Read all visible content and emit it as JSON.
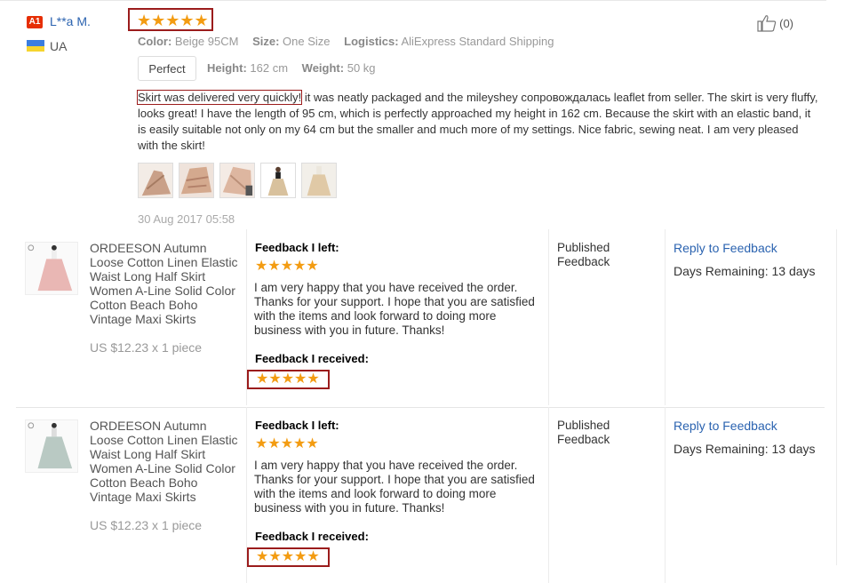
{
  "review": {
    "badge": "A1",
    "username": "L**a M.",
    "country": "UA",
    "stars": "★★★★★",
    "helpful_count": "(0)",
    "color_label": "Color:",
    "color_value": "Beige 95CM",
    "size_label": "Size:",
    "size_value": "One Size",
    "logistics_label": "Logistics:",
    "logistics_value": "AliExpress Standard Shipping",
    "fit": "Perfect",
    "height_label": "Height:",
    "height_value": "162 cm",
    "weight_label": "Weight:",
    "weight_value": "50 kg",
    "text_highlight": "Skirt was delivered very quickly!",
    "text_rest": " it was neatly packaged and the mileyshey сопровождалась leaflet from seller. The skirt is very fluffy, looks great! I have the length of 95 cm, which is perfectly approached my height in 162 cm. Because the skirt with an elastic band, it is easily suitable not only on my 64 cm but the smaller and much more of my settings. Nice fabric, sewing neat. I am very pleased with the skirt!",
    "photos": [
      "photo-1",
      "photo-2",
      "photo-3",
      "photo-4",
      "photo-5"
    ],
    "date": "30 Aug 2017 05:58"
  },
  "orders": [
    {
      "product_name": "ORDEESON Autumn Loose Cotton Linen Elastic Waist Long Half Skirt Women A-Line Solid Color Cotton Beach Boho Vintage Maxi Skirts",
      "price": "US $12.23 x 1 piece",
      "feedback_left_label": "Feedback I left:",
      "feedback_left_stars": "★★★★★",
      "feedback_left_text": "I am very happy that you have received the order. Thanks for your support. I hope that you are satisfied with the items and look forward to doing more business with you in future. Thanks!",
      "feedback_received_label": "Feedback I received:",
      "feedback_received_stars": "★★★★★",
      "status": "Published Feedback",
      "reply_link": "Reply to Feedback",
      "days_remaining": "Days Remaining: 13 days",
      "image_color": "#e9b7b4"
    },
    {
      "product_name": "ORDEESON Autumn Loose Cotton Linen Elastic Waist Long Half Skirt Women A-Line Solid Color Cotton Beach Boho Vintage Maxi Skirts",
      "price": "US $12.23 x 1 piece",
      "feedback_left_label": "Feedback I left:",
      "feedback_left_stars": "★★★★★",
      "feedback_left_text": "I am very happy that you have received the order. Thanks for your support. I hope that you are satisfied with the items and look forward to doing more business with you in future. Thanks!",
      "feedback_received_label": "Feedback I received:",
      "feedback_received_stars": "★★★★★",
      "status": "Published Feedback",
      "reply_link": "Reply to Feedback",
      "days_remaining": "Days Remaining: 13 days",
      "image_color": "#b9c9c3"
    }
  ],
  "colors": {
    "star": "#f39c12",
    "link": "#2b63b0",
    "highlight_border": "#9b1c1c",
    "badge": "#e62e04"
  },
  "icons": {
    "thumbs_up": "thumbs-up-icon",
    "flag": "ukraine-flag-icon"
  }
}
